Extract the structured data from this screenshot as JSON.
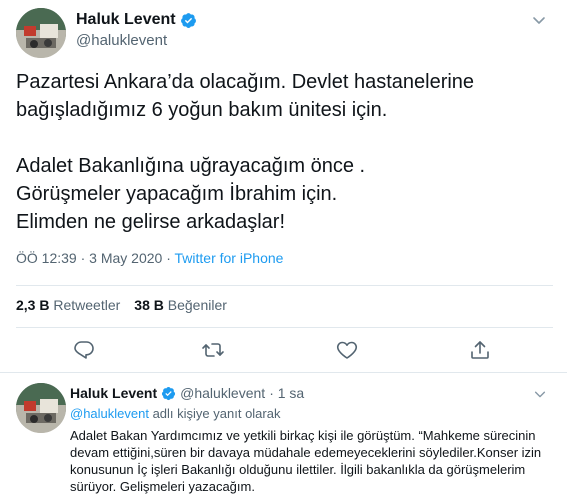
{
  "tweet": {
    "display_name": "Haluk Levent",
    "handle": "@haluklevent",
    "text": "Pazartesi Ankara’da olacağım. Devlet hastanelerine\nbağışladığımız 6 yoğun bakım ünitesi için.\n\nAdalet Bakanlığına uğrayacağım önce .\nGörüşmeler yapacağım İbrahim için.\nElimden ne gelirse arkadaşlar!",
    "timestamp": "ÖÖ 12:39 · 3 May 2020 · ",
    "source": "Twitter for iPhone",
    "retweets_count": "2,3 B",
    "retweets_label": "Retweetler",
    "likes_count": "38 B",
    "likes_label": "Beğeniler"
  },
  "actions": {
    "reply_icon": "reply-icon",
    "retweet_icon": "retweet-icon",
    "like_icon": "heart-icon",
    "share_icon": "share-icon"
  },
  "reply": {
    "display_name": "Haluk Levent",
    "handle": "@haluklevent",
    "time": "· 1 sa",
    "reply_to_mention": "@haluklevent",
    "reply_to_suffix": " adlı kişiye yanıt olarak",
    "text": "Adalet Bakan Yardımcımız ve yetkili birkaç kişi ile görüştüm. “Mahkeme sürecinin devam ettiğini,süren bir davaya müdahale edemeyeceklerini söylediler.Konser izin konusunun İç işleri Bakanlığı olduğunu ilettiler. İlgili bakanlıkla da görüşmelerim sürüyor. Gelişmeleri yazacağım."
  },
  "colors": {
    "accent": "#1d9bf0",
    "secondary_text": "#536471",
    "divider": "#e1e8ed"
  }
}
